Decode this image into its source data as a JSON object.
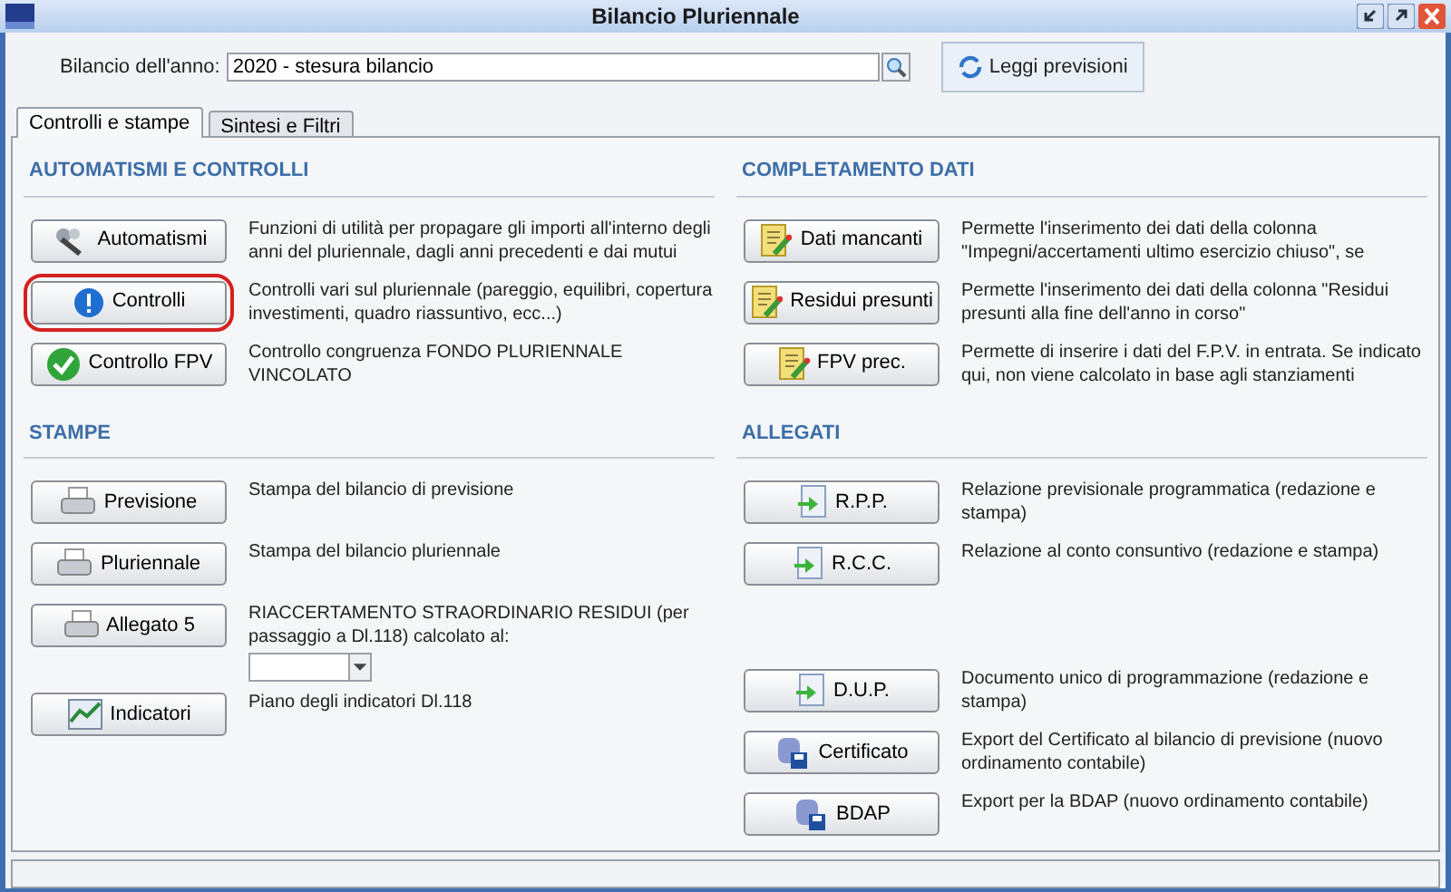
{
  "window": {
    "title": "Bilancio Pluriennale"
  },
  "year": {
    "label": "Bilancio dell'anno:",
    "value": "2020 - stesura bilancio"
  },
  "read_button": {
    "label": "Leggi previsioni"
  },
  "tabs": [
    {
      "label": "Controlli e stampe",
      "selected": true
    },
    {
      "label": "Sintesi e Filtri",
      "selected": false
    }
  ],
  "columns": [
    {
      "sections": [
        {
          "heading": "AUTOMATISMI E CONTROLLI",
          "groups": [
            [
              {
                "kind": "tools",
                "label": "Automatismi",
                "description": "Funzioni di utilità per propagare gli importi all'interno degli anni del pluriennale, dagli anni precedenti e dai mutui",
                "highlighted": false
              },
              {
                "kind": "info",
                "label": "Controlli",
                "description": "Controlli vari sul pluriennale (pareggio, equilibri, copertura investimenti, quadro riassuntivo, ecc...)",
                "highlighted": true
              },
              {
                "kind": "check",
                "label": "Controllo FPV",
                "description": "Controllo congruenza FONDO PLURIENNALE VINCOLATO",
                "highlighted": false
              }
            ]
          ]
        },
        {
          "heading": "STAMPE",
          "groups": [
            [
              {
                "kind": "printer",
                "label": "Previsione",
                "description": "Stampa del bilancio di previsione",
                "highlighted": false
              },
              {
                "kind": "printer",
                "label": "Pluriennale",
                "description": "Stampa del bilancio pluriennale",
                "highlighted": false
              },
              {
                "kind": "printer",
                "label": "Allegato 5",
                "description": "RIACCERTAMENTO STRAORDINARIO RESIDUI (per passaggio a Dl.118) calcolato al:",
                "highlighted": false,
                "date_picker": true
              },
              {
                "kind": "chart",
                "label": "Indicatori",
                "description": "Piano degli indicatori Dl.118",
                "highlighted": false
              }
            ]
          ]
        }
      ]
    },
    {
      "sections": [
        {
          "heading": "COMPLETAMENTO DATI",
          "groups": [
            [
              {
                "kind": "edit",
                "label": "Dati mancanti",
                "description": "Permette l'inserimento dei dati della colonna \"Impegni/accertamenti ultimo esercizio chiuso\", se",
                "highlighted": false
              },
              {
                "kind": "edit",
                "label": "Residui presunti",
                "description": "Permette l'inserimento dei dati della colonna \"Residui presunti alla fine dell'anno in corso\"",
                "highlighted": false
              },
              {
                "kind": "edit",
                "label": "FPV prec.",
                "description": "Permette di inserire i dati del F.P.V. in entrata. Se indicato qui, non viene calcolato in base agli stanziamenti",
                "highlighted": false
              }
            ]
          ]
        },
        {
          "heading": "ALLEGATI",
          "groups": [
            [
              {
                "kind": "document",
                "label": "R.P.P.",
                "description": "Relazione previsionale programmatica (redazione e stampa)",
                "highlighted": false
              },
              {
                "kind": "document",
                "label": "R.C.C.",
                "description": "Relazione al conto consuntivo (redazione e stampa)",
                "highlighted": false
              }
            ],
            [
              {
                "kind": "document",
                "label": "D.U.P.",
                "description": "Documento unico di programmazione (redazione e stampa)",
                "highlighted": false
              },
              {
                "kind": "database",
                "label": "Certificato",
                "description": "Export del Certificato al bilancio di previsione (nuovo ordinamento contabile)",
                "highlighted": false
              },
              {
                "kind": "database",
                "label": "BDAP",
                "description": "Export per la BDAP (nuovo ordinamento contabile)",
                "highlighted": false
              }
            ]
          ]
        }
      ]
    }
  ]
}
